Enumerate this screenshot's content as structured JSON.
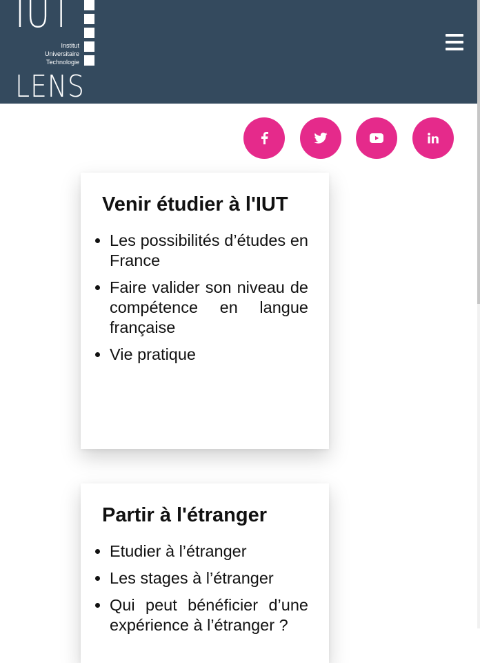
{
  "header": {
    "logo": {
      "top_text": "IUT",
      "line1": "Institut",
      "line2": "Universitaire",
      "line3": "Technologie",
      "bottom_text": "LENS"
    },
    "menu_icon": "hamburger-menu-icon"
  },
  "social": [
    {
      "name": "facebook",
      "icon": "facebook-icon"
    },
    {
      "name": "twitter",
      "icon": "twitter-icon"
    },
    {
      "name": "youtube",
      "icon": "youtube-icon"
    },
    {
      "name": "linkedin",
      "icon": "linkedin-icon"
    }
  ],
  "cards": [
    {
      "title": "Venir étudier à l'IUT",
      "items": [
        "Les possibilités d’études en France",
        "Faire valider son niveau de compétence en langue française",
        "Vie pratique"
      ]
    },
    {
      "title": "Partir à l'étranger",
      "items": [
        "Etudier à l’étranger",
        "Les stages à l’étranger",
        "Qui peut bénéficier d’une expérience à l’étranger ?"
      ]
    }
  ],
  "colors": {
    "header_bg": "#344a5e",
    "social_bg": "#e52a8b"
  }
}
